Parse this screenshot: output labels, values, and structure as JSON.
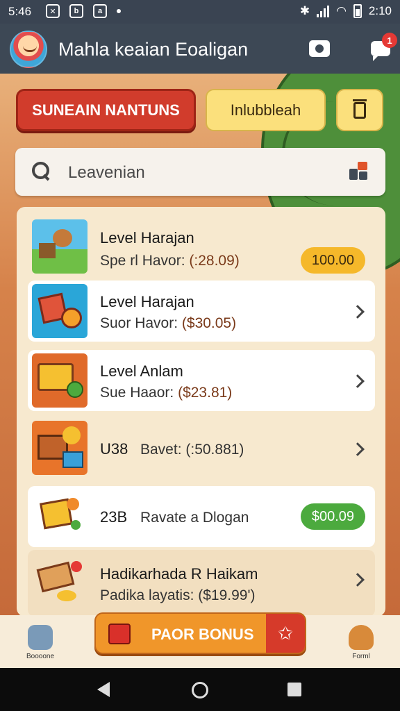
{
  "status_bar": {
    "time_left": "5:46",
    "time_right": "2:10",
    "icon_b": "b",
    "icon_a": "a"
  },
  "header": {
    "title": "Mahla keaian Eoaligan",
    "notification_count": "1"
  },
  "actions": {
    "primary_button": "SUNEAIN NANTUNS",
    "secondary_button": "Inlubbleah"
  },
  "search": {
    "value": "Leavenian"
  },
  "list": [
    {
      "title": "Level Harajan",
      "sub_label": "Spe rl Havor: ",
      "sub_price": "(:28.09)",
      "pill": "100.00",
      "pill_style": "gold"
    },
    {
      "title": "Level Harajan",
      "sub_label": "Suor Havor: ",
      "sub_price": "($30.05)",
      "pill": "",
      "pill_style": "chevron"
    },
    {
      "title": "Level Anlam",
      "sub_label": "Sue Haaor: ",
      "sub_price": "($23.81)",
      "pill": "",
      "pill_style": "chevron"
    },
    {
      "title": "U38",
      "sub_label": "Bavet: (:50.881)",
      "sub_price": "",
      "pill": "",
      "pill_style": "chevron"
    },
    {
      "title": "23B",
      "sub_label": "Ravate a Dlogan",
      "sub_price": "",
      "pill": "$00.09",
      "pill_style": "green"
    },
    {
      "title": "Hadikarhada R Haikam",
      "sub_label": "Padika layatis: ($19.99')",
      "sub_price": "",
      "pill": "",
      "pill_style": "chevron"
    }
  ],
  "bottom_nav": {
    "left_label": "Boooone",
    "bonus_label": "PAOR BONUS",
    "right_label": "Forml"
  },
  "colors": {
    "primary_red": "#d13c2c",
    "accent_yellow": "#fbe07c",
    "gold_pill": "#f5b82a",
    "green_pill": "#4caa3e",
    "bonus_orange": "#f0962a"
  }
}
